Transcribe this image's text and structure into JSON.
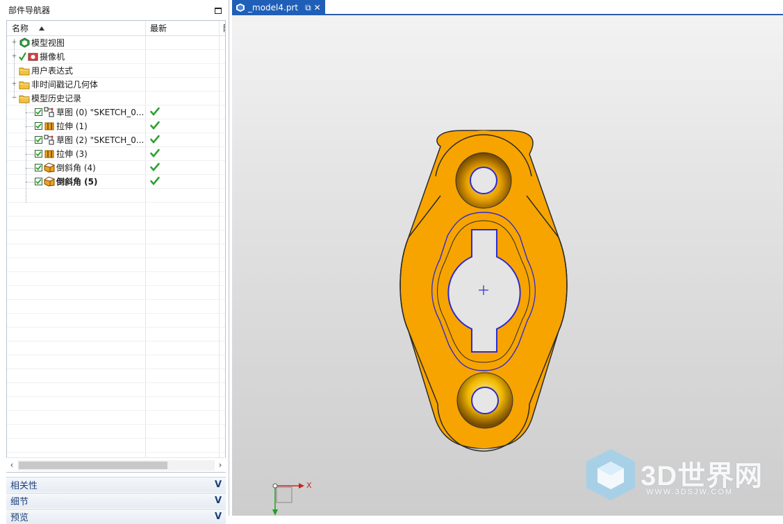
{
  "navigator": {
    "title": "部件导航器",
    "columns": {
      "name": "名称",
      "latest": "最新",
      "attach": "附"
    },
    "rows": [
      {
        "label": "模型视图",
        "expander": "+",
        "icon": "model-view-icon",
        "check": false,
        "latest": false,
        "bold": false,
        "level": 0
      },
      {
        "label": "摄像机",
        "expander": "+",
        "icon": "camera-icon",
        "check": false,
        "latest": false,
        "bold": false,
        "level": 0
      },
      {
        "label": "用户表达式",
        "expander": "",
        "icon": "folder-icon",
        "check": false,
        "latest": false,
        "bold": false,
        "level": 0
      },
      {
        "label": "非时间戳记几何体",
        "expander": "+",
        "icon": "folder-icon",
        "check": false,
        "latest": false,
        "bold": false,
        "level": 0
      },
      {
        "label": "模型历史记录",
        "expander": "−",
        "icon": "folder-icon",
        "check": false,
        "latest": false,
        "bold": false,
        "level": 0
      },
      {
        "label": "草图 (0) \"SKETCH_0...",
        "expander": "",
        "icon": "sketch-icon",
        "check": true,
        "latest": true,
        "bold": false,
        "level": 1
      },
      {
        "label": "拉伸 (1)",
        "expander": "",
        "icon": "extrude-icon",
        "check": true,
        "latest": true,
        "bold": false,
        "level": 1
      },
      {
        "label": "草图 (2) \"SKETCH_0...",
        "expander": "",
        "icon": "sketch-icon",
        "check": true,
        "latest": true,
        "bold": false,
        "level": 1
      },
      {
        "label": "拉伸 (3)",
        "expander": "",
        "icon": "extrude-icon",
        "check": true,
        "latest": true,
        "bold": false,
        "level": 1
      },
      {
        "label": "倒斜角 (4)",
        "expander": "",
        "icon": "chamfer-icon",
        "check": true,
        "latest": true,
        "bold": false,
        "level": 1
      },
      {
        "label": "倒斜角 (5)",
        "expander": "",
        "icon": "chamfer-icon",
        "check": true,
        "latest": true,
        "bold": true,
        "level": 1
      }
    ],
    "empty_rows": 20,
    "sections": [
      {
        "label": "相关性"
      },
      {
        "label": "细节"
      },
      {
        "label": "预览"
      }
    ]
  },
  "document_tab": {
    "label": "_model4.prt"
  },
  "triad": {
    "x_label": "X"
  },
  "watermark": {
    "text": "3D世界网",
    "url": "WWW.3DSJW.COM"
  },
  "colors": {
    "part_fill": "#f7a400",
    "edge": "#2e2ad0",
    "tab_active": "#1f5fb8",
    "section_text": "#1d3f7a",
    "check_green": "#2fa12f"
  }
}
